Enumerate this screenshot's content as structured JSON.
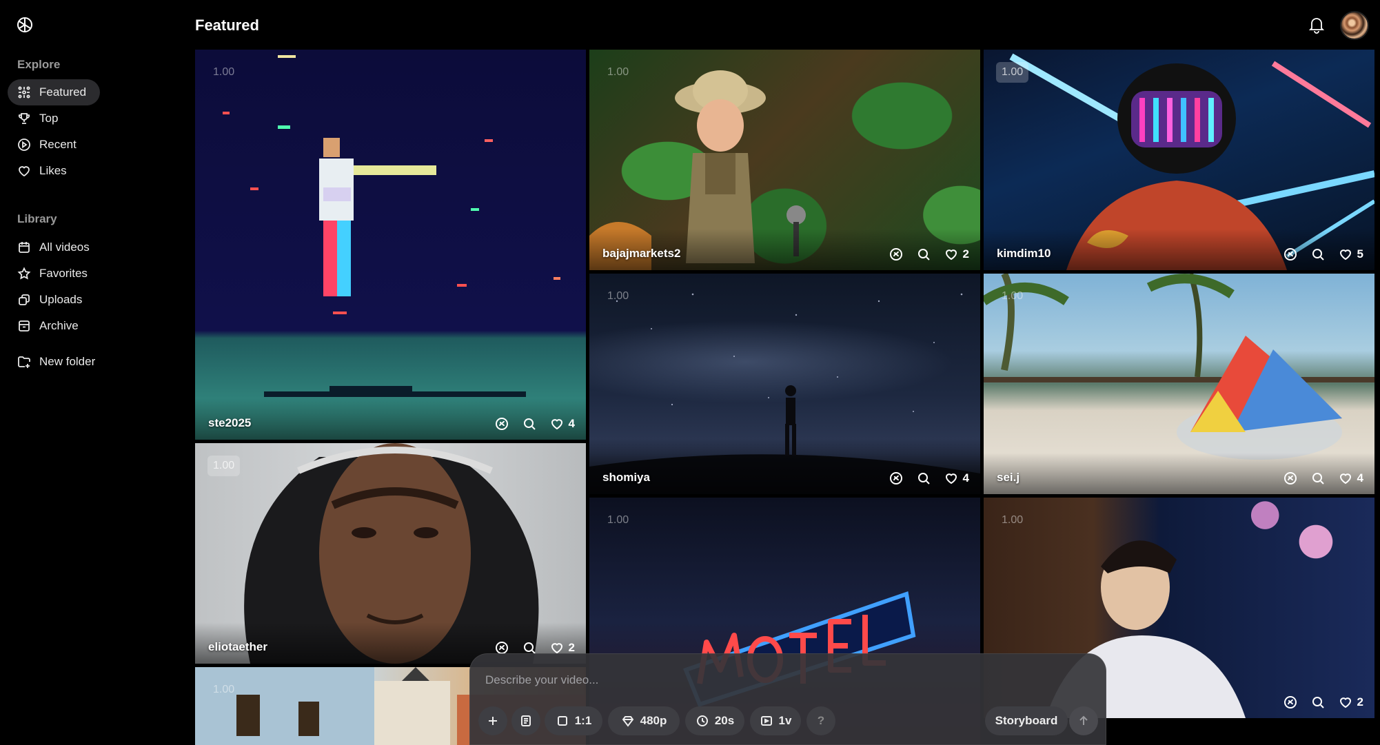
{
  "header": {
    "title": "Featured"
  },
  "sidebar": {
    "explore_title": "Explore",
    "explore_items": [
      {
        "label": "Featured",
        "icon": "sparkle-icon",
        "active": true
      },
      {
        "label": "Top",
        "icon": "trophy-icon"
      },
      {
        "label": "Recent",
        "icon": "play-circle-icon"
      },
      {
        "label": "Likes",
        "icon": "heart-icon"
      }
    ],
    "library_title": "Library",
    "library_items": [
      {
        "label": "All videos",
        "icon": "calendar-icon"
      },
      {
        "label": "Favorites",
        "icon": "star-icon"
      },
      {
        "label": "Uploads",
        "icon": "upload-icon"
      },
      {
        "label": "Archive",
        "icon": "archive-icon"
      }
    ],
    "new_folder": "New folder"
  },
  "videos": [
    {
      "user": "ste2025",
      "badge": "1.00",
      "likes": "4"
    },
    {
      "user": "bajajmarkets2",
      "badge": "1.00",
      "likes": "2"
    },
    {
      "user": "kimdim10",
      "badge": "1.00",
      "likes": "5"
    },
    {
      "user": "shomiya",
      "badge": "1.00",
      "likes": "4"
    },
    {
      "user": "sei.j",
      "badge": "1.00",
      "likes": "4"
    },
    {
      "user": "eliotaether",
      "badge": "1.00",
      "likes": "2"
    },
    {
      "user": "",
      "badge": "1.00",
      "likes": ""
    },
    {
      "user": "",
      "badge": "1.00",
      "likes": "2"
    },
    {
      "user": "",
      "badge": "1.00",
      "likes": ""
    }
  ],
  "composer": {
    "placeholder": "Describe your video...",
    "aspect": "1:1",
    "resolution": "480p",
    "duration": "20s",
    "variations": "1v",
    "help": "?",
    "storyboard": "Storyboard"
  },
  "colors": {
    "accent_bg": "#2b2b2e",
    "composer_bg": "#343438"
  }
}
